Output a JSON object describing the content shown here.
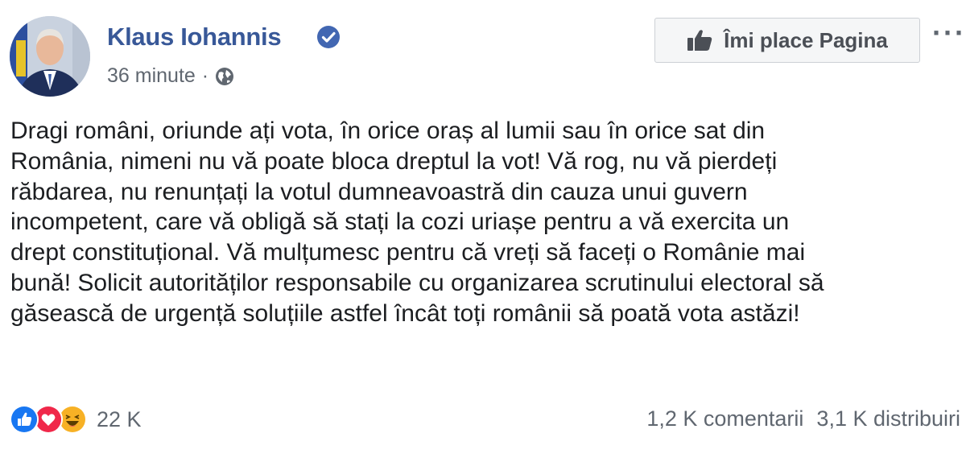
{
  "post": {
    "author": "Klaus Iohannis",
    "time": "36 minute",
    "separator": "·",
    "text": "Dragi români, oriunde ați vota, în orice oraș al lumii sau în orice sat din\nRomânia, nimeni nu vă poate bloca dreptul la vot! Vă rog, nu vă pierdeți\nrăbdarea, nu renunțați la votul dumneavoastră din cauza unui guvern\nincompetent, care vă obligă să stați la cozi uriașe pentru a vă exercita un\ndrept constituțional. Vă mulțumesc pentru că vreți să faceți o Românie mai\nbună! Solicit autorităților responsabile cu organizarea scrutinului electoral să\ngăsească de urgență soluțiile astfel încât toți românii să poată vota astăzi!"
  },
  "header": {
    "like_page_label": "Îmi place Pagina",
    "more_label": "···"
  },
  "footer": {
    "reaction_count": "22 K",
    "comments": "1,2 K comentarii",
    "shares": "3,1 K distribuiri"
  },
  "icons": {
    "verified": "verified-badge-icon",
    "audience": "globe-icon",
    "like_button": "thumbs-up-icon",
    "reactions": [
      "like-reaction-icon",
      "love-reaction-icon",
      "haha-reaction-icon"
    ]
  },
  "colors": {
    "author_link": "#385898",
    "verified_badge": "#4267b2",
    "like_reaction": "#1877f2",
    "love_reaction": "#f0284a",
    "haha_reaction": "#f7b125",
    "secondary_text": "#606770"
  }
}
